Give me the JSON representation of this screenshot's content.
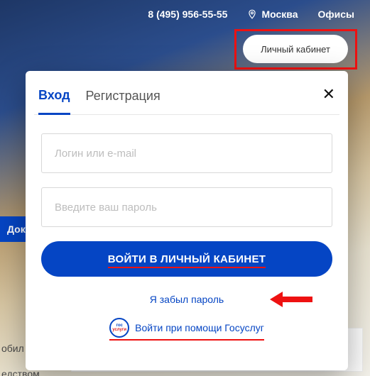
{
  "topbar": {
    "phone": "8 (495) 956-55-55",
    "city": "Москва",
    "offices": "Офисы"
  },
  "account_button": "Личный кабинет",
  "nav_doc": "Док",
  "footer": {
    "line1": "обил",
    "line2": "едством."
  },
  "modal": {
    "tabs": {
      "login": "Вход",
      "register": "Регистрация"
    },
    "login_placeholder": "Логин или e-mail",
    "password_placeholder": "Введите ваш пароль",
    "submit": "ВОЙТИ В ЛИЧНЫЙ КАБИНЕТ",
    "forgot": "Я забыл пароль",
    "gos_badge": {
      "line1": "гос",
      "line2": "услуги"
    },
    "gos_link": "Войти при помощи Госуслуг"
  },
  "colors": {
    "primary": "#0545c4",
    "highlight": "#e11"
  }
}
